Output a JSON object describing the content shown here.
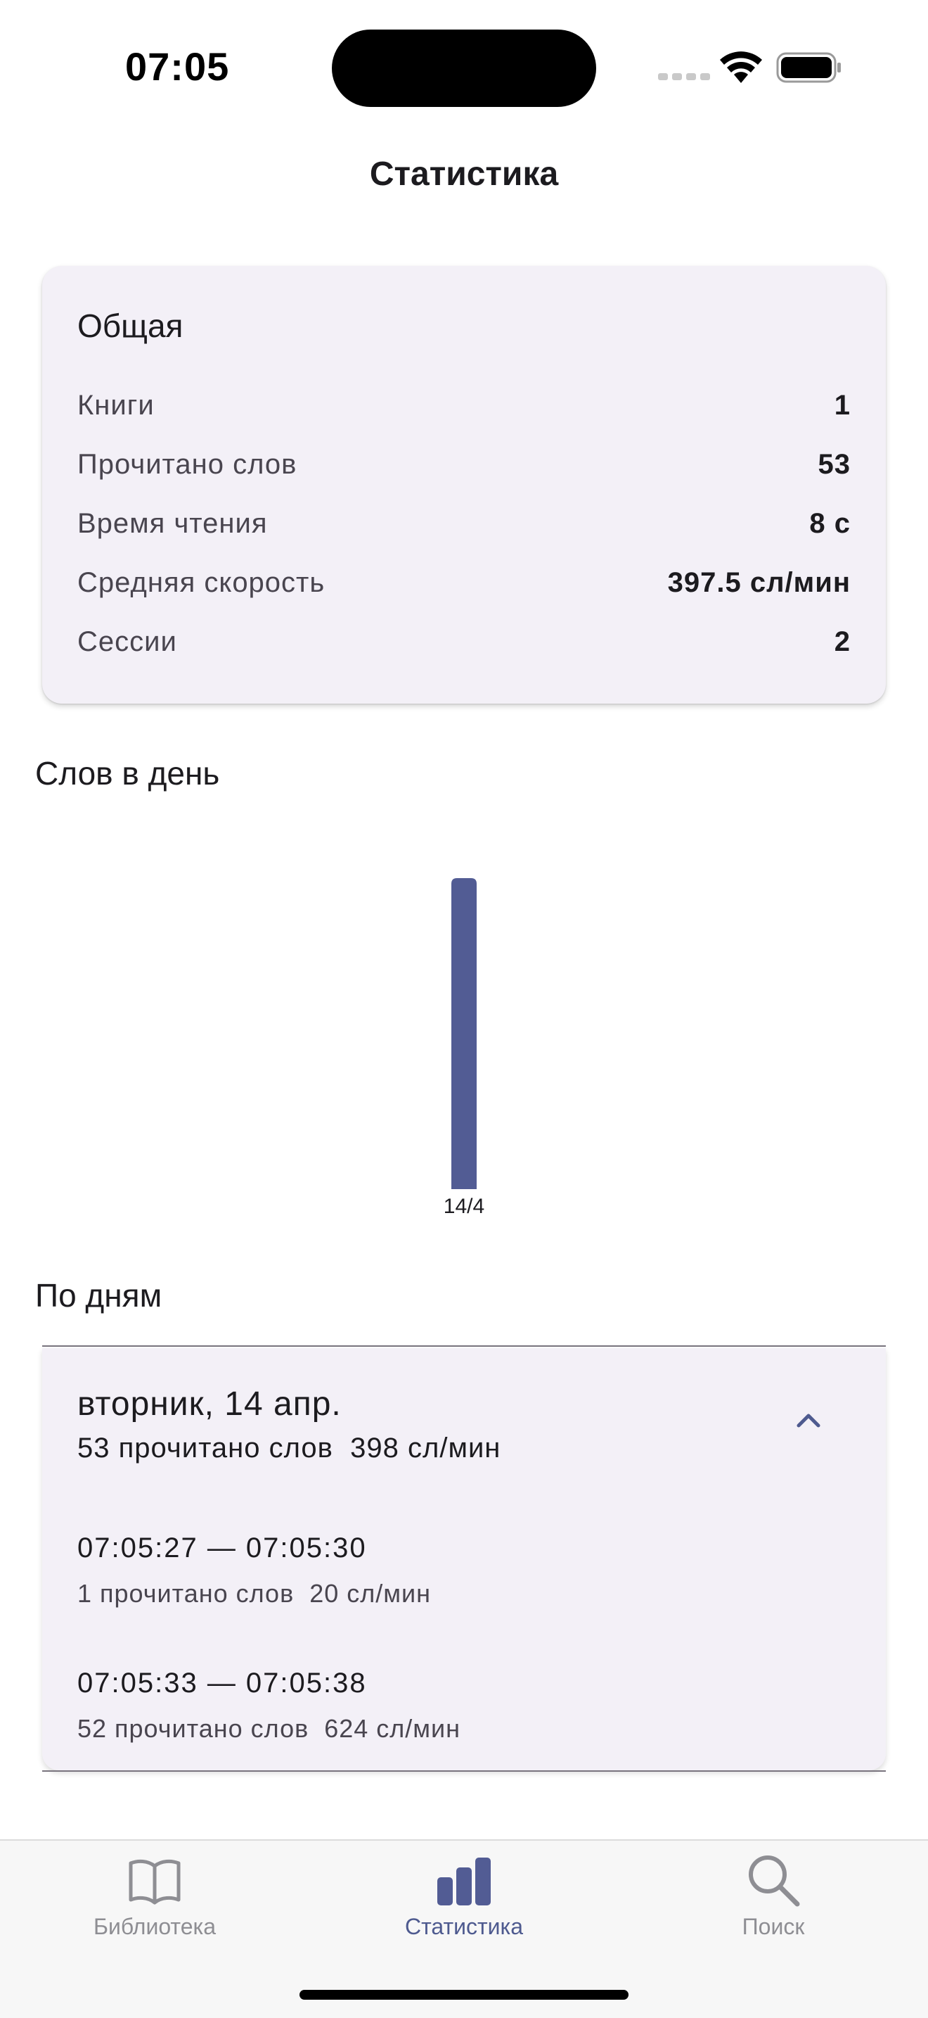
{
  "status_bar": {
    "time": "07:05"
  },
  "header": {
    "title": "Статистика"
  },
  "general": {
    "title": "Общая",
    "rows": [
      {
        "label": "Книги",
        "value": "1"
      },
      {
        "label": "Прочитано слов",
        "value": "53"
      },
      {
        "label": "Время чтения",
        "value": "8 с"
      },
      {
        "label": "Средняя скорость",
        "value": "397.5 сл/мин"
      },
      {
        "label": "Сессии",
        "value": "2"
      }
    ]
  },
  "words_per_day": {
    "title": "Слов в день"
  },
  "chart_data": {
    "type": "bar",
    "categories": [
      "14/4"
    ],
    "values": [
      53
    ],
    "ylim": [
      0,
      53
    ],
    "grid": false,
    "bar_color": "#525c94"
  },
  "by_days": {
    "title": "По дням",
    "days": [
      {
        "date": "вторник, 14 апр.",
        "summary": "53 прочитано слов  398 сл/мин",
        "expanded": true,
        "sessions": [
          {
            "time": "07:05:27 — 07:05:30",
            "summary": "1 прочитано слов  20 сл/мин"
          },
          {
            "time": "07:05:33 — 07:05:38",
            "summary": "52 прочитано слов  624 сл/мин"
          }
        ]
      }
    ]
  },
  "tab_bar": {
    "tabs": [
      {
        "label": "Библиотека",
        "icon": "book-icon",
        "active": false
      },
      {
        "label": "Статистика",
        "icon": "bar-chart-icon",
        "active": true
      },
      {
        "label": "Поиск",
        "icon": "search-icon",
        "active": false
      }
    ]
  },
  "colors": {
    "accent": "#525c94",
    "active_tab": "#4e5a8f",
    "inactive_tab": "#8e8e93",
    "card_bg": "#f3f0f7"
  }
}
